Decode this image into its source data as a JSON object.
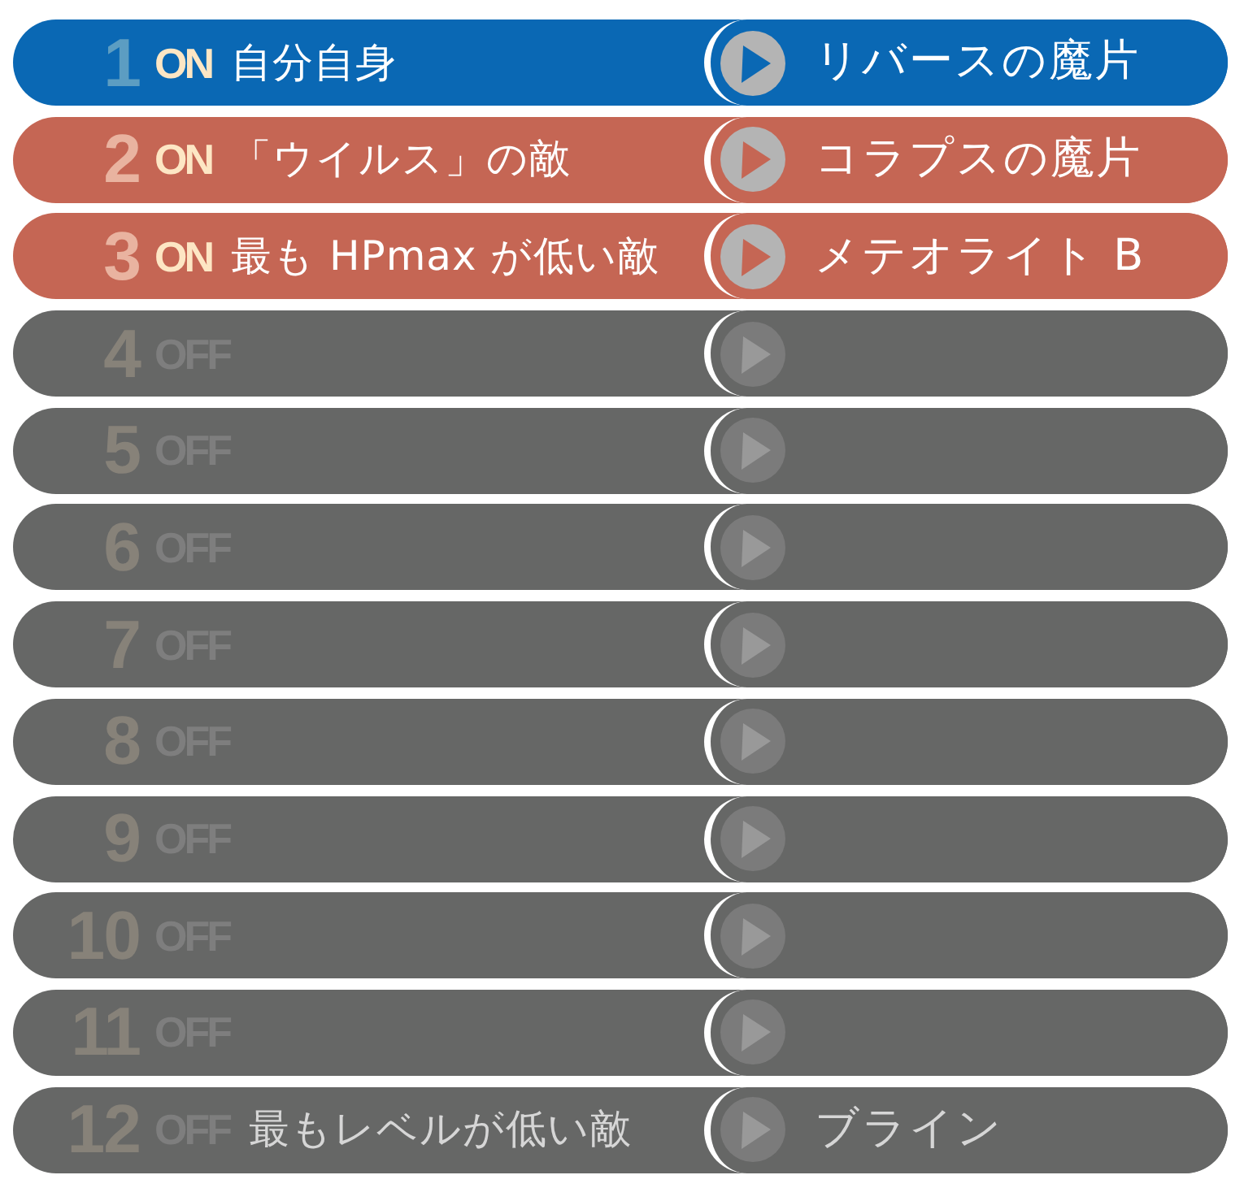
{
  "gambits": [
    {
      "number": "1",
      "status": "ON",
      "on": true,
      "selected": true,
      "condition": "自分自身",
      "action": "リバースの魔片"
    },
    {
      "number": "2",
      "status": "ON",
      "on": true,
      "selected": false,
      "condition": "「ウイルス」の敵",
      "action": "コラプスの魔片"
    },
    {
      "number": "3",
      "status": "ON",
      "on": true,
      "selected": false,
      "condition": "最も HPmax が低い敵",
      "action": "メテオライト B"
    },
    {
      "number": "4",
      "status": "OFF",
      "on": false,
      "selected": false
    },
    {
      "number": "5",
      "status": "OFF",
      "on": false,
      "selected": false
    },
    {
      "number": "6",
      "status": "OFF",
      "on": false,
      "selected": false
    },
    {
      "number": "7",
      "status": "OFF",
      "on": false,
      "selected": false
    },
    {
      "number": "8",
      "status": "OFF",
      "on": false,
      "selected": false
    },
    {
      "number": "9",
      "status": "OFF",
      "on": false,
      "selected": false
    },
    {
      "number": "10",
      "status": "OFF",
      "on": false,
      "selected": false
    },
    {
      "number": "11",
      "status": "OFF",
      "on": false,
      "selected": false
    },
    {
      "number": "12",
      "status": "OFF",
      "on": false,
      "selected": false,
      "condition": "最もレベルが低い敵",
      "action": "ブライン"
    }
  ]
}
